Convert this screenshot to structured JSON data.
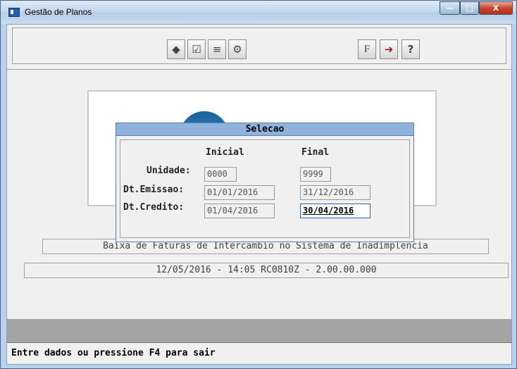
{
  "window": {
    "title": "Gestão de Planos",
    "controls": {
      "minimize": "—",
      "maximize": "□",
      "close": "X"
    }
  },
  "toolbar": {
    "buttons": [
      {
        "name": "action-icon",
        "glyph": "◆"
      },
      {
        "name": "checklist-icon",
        "glyph": "☑"
      },
      {
        "name": "list-icon",
        "glyph": "≡"
      },
      {
        "name": "gears-icon",
        "glyph": "⚙"
      },
      {
        "name": "f-icon",
        "glyph": "F"
      },
      {
        "name": "exit-door-icon",
        "glyph": "➜"
      },
      {
        "name": "help-icon",
        "glyph": "?"
      }
    ]
  },
  "dialog": {
    "title": "Selecao",
    "col_initial": "Inicial",
    "col_final": "Final",
    "rows": [
      {
        "label": "Unidade:",
        "initial": "0000",
        "final": "9999"
      },
      {
        "label": "Dt.Emissao:",
        "initial": "01/01/2016",
        "final": "31/12/2016"
      },
      {
        "label": "Dt.Credito:",
        "initial": "01/04/2016",
        "final": "30/04/2016"
      }
    ]
  },
  "program": {
    "description": "Baixa de Faturas de Intercambio no Sistema de Inadimplencia",
    "version_line": "12/05/2016 - 14:05  RC0810Z - 2.00.00.000"
  },
  "status_bar": {
    "message": "Entre dados ou pressione F4 para sair"
  }
}
